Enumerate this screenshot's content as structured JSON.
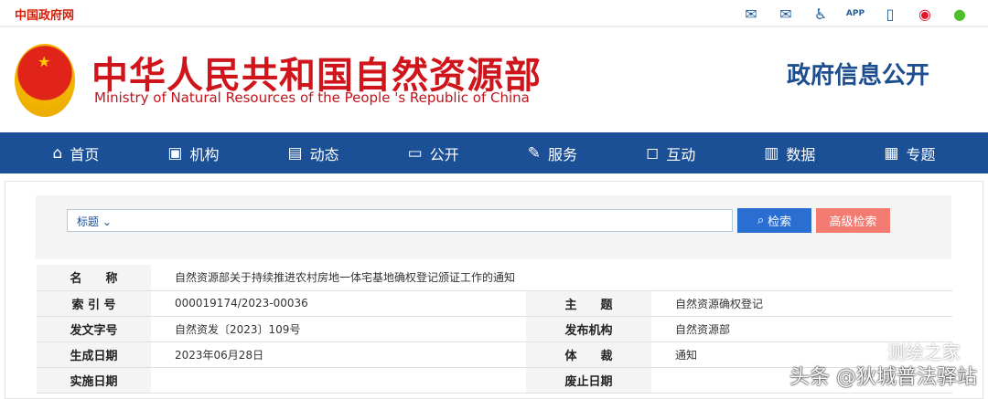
{
  "topbar": {
    "gov_link": "中国政府网",
    "icons": [
      "mail-icon",
      "mail-settings-icon",
      "accessibility-icon",
      "app-icon",
      "mobile-icon",
      "weibo-icon",
      "wechat-icon"
    ],
    "app_text": "APP"
  },
  "header": {
    "title": "中华人民共和国自然资源部",
    "subtitle": "Ministry of Natural Resources of the People 's Republic of China",
    "section": "政府信息公开"
  },
  "nav": [
    {
      "icon": "home-icon",
      "glyph": "⌂",
      "label": "首页"
    },
    {
      "icon": "org-icon",
      "glyph": "▣",
      "label": "机构"
    },
    {
      "icon": "news-icon",
      "glyph": "▤",
      "label": "动态"
    },
    {
      "icon": "public-icon",
      "glyph": "▭",
      "label": "公开"
    },
    {
      "icon": "service-icon",
      "glyph": "✎",
      "label": "服务"
    },
    {
      "icon": "interact-icon",
      "glyph": "◻",
      "label": "互动"
    },
    {
      "icon": "data-icon",
      "glyph": "▥",
      "label": "数据"
    },
    {
      "icon": "topic-icon",
      "glyph": "▦",
      "label": "专题"
    }
  ],
  "search": {
    "field": "标题",
    "search_label": "检索",
    "advanced_label": "高级检索"
  },
  "meta": {
    "name_label": "名　　称",
    "name": "自然资源部关于持续推进农村房地一体宅基地确权登记颁证工作的通知",
    "index_label": "索 引 号",
    "index": "000019174/2023-00036",
    "subject_label": "主　　题",
    "subject": "自然资源确权登记",
    "docno_label": "发文字号",
    "docno": "自然资发〔2023〕109号",
    "publisher_label": "发布机构",
    "publisher": "自然资源部",
    "date_label": "生成日期",
    "date": "2023年06月28日",
    "genre_label": "体　　裁",
    "genre": "通知",
    "effective_label": "实施日期",
    "effective": "",
    "expiry_label": "废止日期",
    "expiry": ""
  },
  "watermark": {
    "line1": "测绘之家",
    "line2": "头条 @狄城普法驿站"
  }
}
